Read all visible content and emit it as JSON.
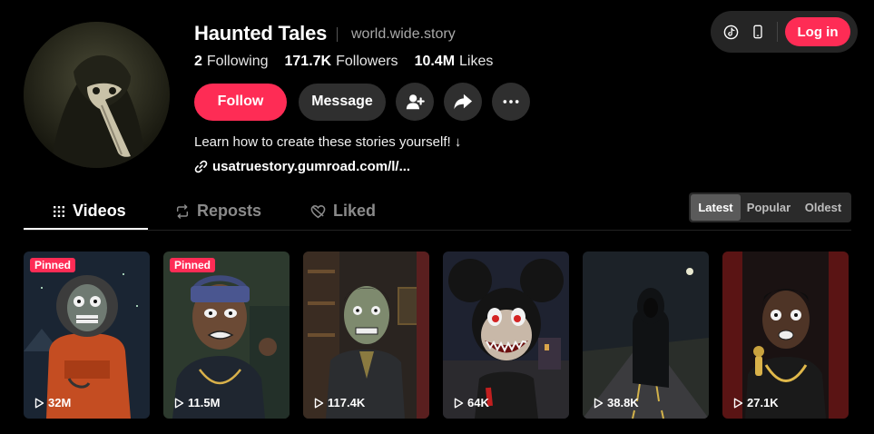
{
  "profile": {
    "username": "Haunted Tales",
    "nickname": "world.wide.story",
    "following_count": "2",
    "following_label": "Following",
    "followers_count": "171.7K",
    "followers_label": "Followers",
    "likes_count": "10.4M",
    "likes_label": "Likes",
    "bio": "Learn how to create these stories yourself! ↓",
    "link": "usatruestory.gumroad.com/l/..."
  },
  "actions": {
    "follow_label": "Follow",
    "message_label": "Message",
    "icons": [
      "add-friend-icon",
      "share-icon",
      "more-icon"
    ]
  },
  "topbar": {
    "icons": [
      "tiktok-icon",
      "phone-icon"
    ],
    "login_label": "Log in"
  },
  "tabs": [
    {
      "label": "Videos",
      "icon": "grid-icon",
      "active": true
    },
    {
      "label": "Reposts",
      "icon": "repost-icon",
      "active": false
    },
    {
      "label": "Liked",
      "icon": "heart-icon",
      "active": false
    }
  ],
  "sort": {
    "options": [
      "Latest",
      "Popular",
      "Oldest"
    ],
    "selected": "Latest"
  },
  "videos": [
    {
      "views": "32M",
      "pinned": true,
      "pinned_label": "Pinned"
    },
    {
      "views": "11.5M",
      "pinned": true,
      "pinned_label": "Pinned"
    },
    {
      "views": "117.4K",
      "pinned": false
    },
    {
      "views": "64K",
      "pinned": false
    },
    {
      "views": "38.8K",
      "pinned": false
    },
    {
      "views": "27.1K",
      "pinned": false
    }
  ],
  "colors": {
    "accent": "#fe2c55",
    "background": "#000000",
    "button_secondary": "#2f2f2f"
  }
}
